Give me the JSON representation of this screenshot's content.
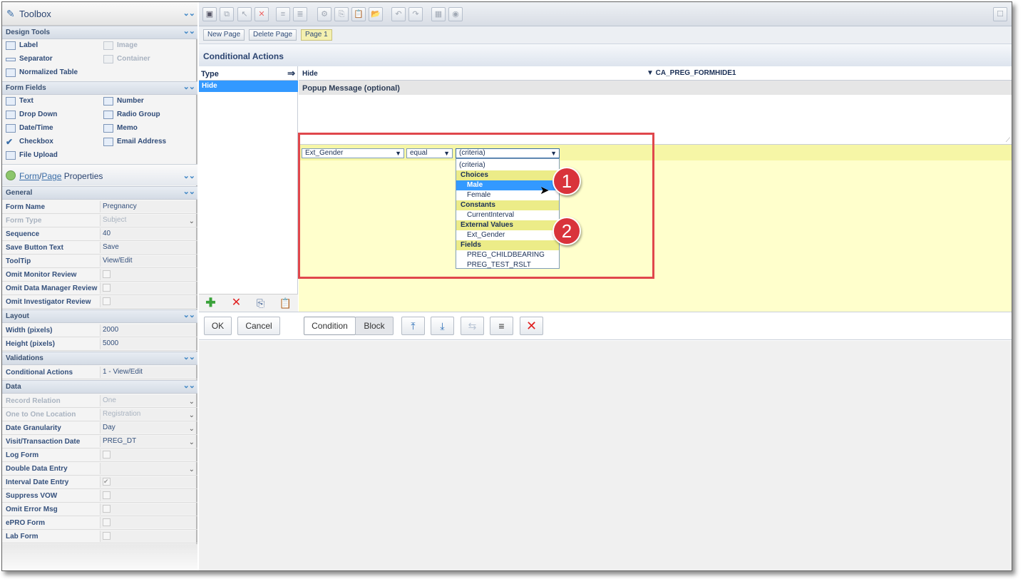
{
  "toolbox": {
    "title": "Toolbox"
  },
  "design_tools": {
    "title": "Design Tools",
    "items": [
      {
        "label": "Label",
        "icon": "label-icon",
        "enabled": true
      },
      {
        "label": "Image",
        "icon": "image-icon",
        "enabled": false
      },
      {
        "label": "Separator",
        "icon": "separator-icon",
        "enabled": true
      },
      {
        "label": "Container",
        "icon": "container-icon",
        "enabled": false
      },
      {
        "label": "Normalized Table",
        "icon": "table-icon",
        "enabled": true
      }
    ]
  },
  "form_fields": {
    "title": "Form Fields",
    "items": [
      {
        "label": "Text",
        "icon": "text-field-icon"
      },
      {
        "label": "Number",
        "icon": "number-field-icon"
      },
      {
        "label": "Drop Down",
        "icon": "dropdown-field-icon"
      },
      {
        "label": "Radio Group",
        "icon": "radio-group-icon"
      },
      {
        "label": "Date/Time",
        "icon": "date-time-icon"
      },
      {
        "label": "Memo",
        "icon": "memo-icon"
      },
      {
        "label": "Checkbox",
        "icon": "checkbox-icon"
      },
      {
        "label": "Email Address",
        "icon": "email-icon"
      },
      {
        "label": "File Upload",
        "icon": "file-upload-icon"
      }
    ]
  },
  "properties": {
    "link_form": "Form",
    "sep": "/",
    "link_page": "Page",
    "suffix": " Properties"
  },
  "general": {
    "title": "General",
    "rows": [
      {
        "key": "Form Name",
        "value": "Pregnancy",
        "disabled": false
      },
      {
        "key": "Form Type",
        "value": "Subject",
        "disabled": true,
        "dropdown": true
      },
      {
        "key": "Sequence",
        "value": "40"
      },
      {
        "key": "Save Button Text",
        "value": "Save"
      },
      {
        "key": "ToolTip",
        "value": "View/Edit"
      },
      {
        "key": "Omit Monitor Review",
        "value": "",
        "checkbox": true
      },
      {
        "key": "Omit Data Manager Review",
        "value": "",
        "checkbox": true
      },
      {
        "key": "Omit Investigator Review",
        "value": "",
        "checkbox": true
      }
    ]
  },
  "layout": {
    "title": "Layout",
    "rows": [
      {
        "key": "Width (pixels)",
        "value": "2000"
      },
      {
        "key": "Height (pixels)",
        "value": "5000"
      }
    ]
  },
  "validations": {
    "title": "Validations",
    "rows": [
      {
        "key": "Conditional Actions",
        "value": "1 - View/Edit"
      }
    ]
  },
  "data": {
    "title": "Data",
    "rows": [
      {
        "key": "Record Relation",
        "value": "One",
        "disabled": true,
        "dropdown": true
      },
      {
        "key": "One to One Location",
        "value": "Registration",
        "disabled": true,
        "dropdown": true
      },
      {
        "key": "Date Granularity",
        "value": "Day",
        "dropdown": true
      },
      {
        "key": "Visit/Transaction Date",
        "value": "PREG_DT",
        "dropdown": true
      },
      {
        "key": "Log Form",
        "value": "",
        "checkbox": true
      },
      {
        "key": "Double Data Entry",
        "value": "",
        "dropdown": true
      },
      {
        "key": "Interval Date Entry",
        "value": "",
        "checkbox": true,
        "checked": true
      },
      {
        "key": "Suppress VOW",
        "value": "",
        "checkbox": true
      },
      {
        "key": "Omit Error Msg",
        "value": "",
        "checkbox": true
      },
      {
        "key": "ePRO Form",
        "value": "",
        "checkbox": true
      },
      {
        "key": "Lab Form",
        "value": "",
        "checkbox": true
      }
    ]
  },
  "pages": {
    "new_page": "New Page",
    "delete_page": "Delete Page",
    "page1": "Page 1"
  },
  "conditional_actions": {
    "title": "Conditional Actions",
    "type_header": "Type",
    "type_arrow": "⇒",
    "types": [
      "Hide"
    ],
    "selected_type": "Hide",
    "action_label": "Hide",
    "target_value": "▼ CA_PREG_FORMHIDE1",
    "popup_label": "Popup Message (optional)"
  },
  "condition": {
    "field": "Ext_Gender",
    "operator": "equal",
    "criteria": "(criteria)",
    "dropdown_options": [
      {
        "kind": "option",
        "label": "(criteria)",
        "indent": false
      },
      {
        "kind": "group",
        "label": "Choices"
      },
      {
        "kind": "option",
        "label": "Male",
        "selected": true
      },
      {
        "kind": "option",
        "label": "Female"
      },
      {
        "kind": "group",
        "label": "Constants"
      },
      {
        "kind": "option",
        "label": "CurrentInterval"
      },
      {
        "kind": "group",
        "label": "External Values"
      },
      {
        "kind": "option",
        "label": "Ext_Gender"
      },
      {
        "kind": "group",
        "label": "Fields"
      },
      {
        "kind": "option",
        "label": "PREG_CHILDBEARING"
      },
      {
        "kind": "option",
        "label": "PREG_TEST_RSLT"
      }
    ]
  },
  "buttons": {
    "ok": "OK",
    "cancel": "Cancel",
    "condition": "Condition",
    "block": "Block"
  },
  "callouts": [
    "1",
    "2"
  ],
  "colors": {
    "accent": "#3399ff",
    "highlight": "#ffffcc",
    "group": "#ecec88",
    "callout": "#d9333b",
    "annotation_box": "#e0474c"
  }
}
